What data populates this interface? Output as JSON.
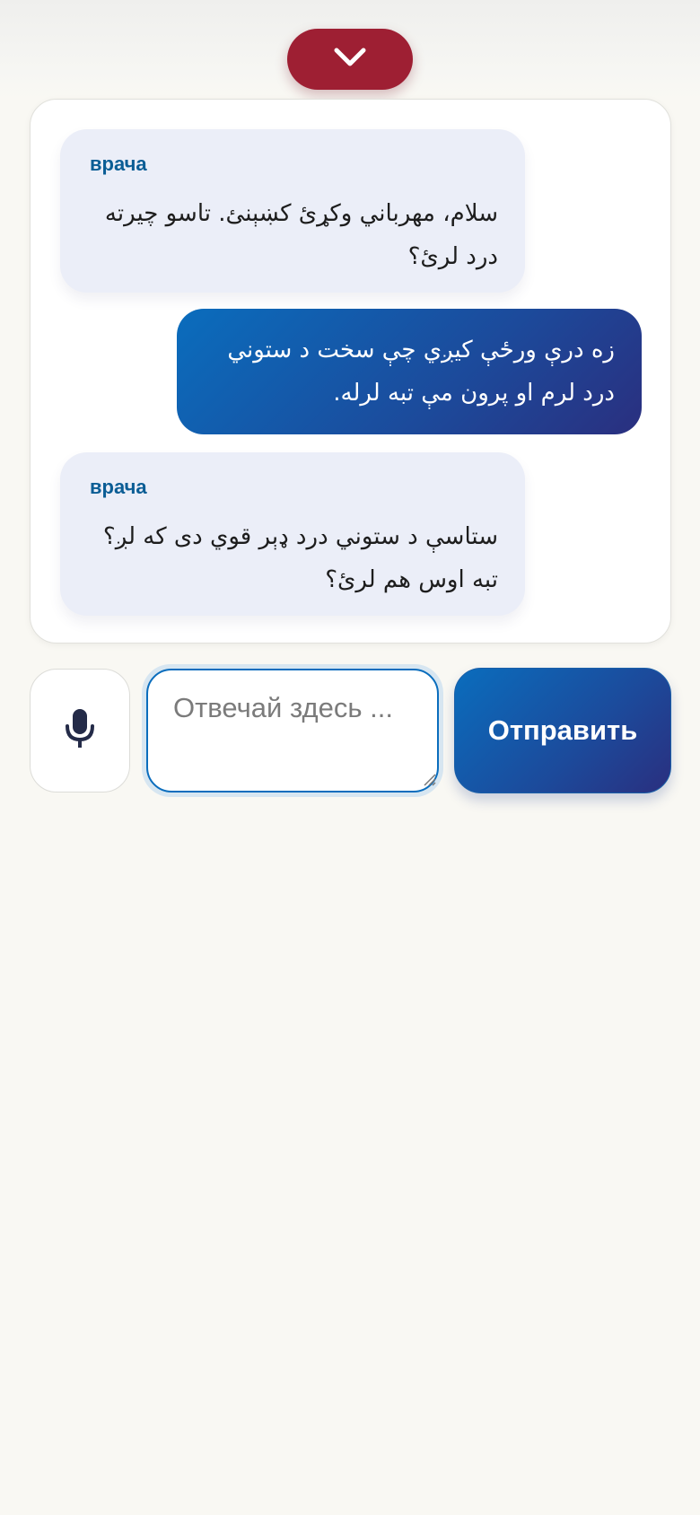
{
  "header": {
    "collapse_icon": "chevron-down-icon",
    "collapse_color": "#9e1f33"
  },
  "chat": {
    "messages": [
      {
        "role": "doctor",
        "sender": "врача",
        "lines": [
          "سلام، مهرباني وکړئ کښېنئ. تاسو چیرته",
          "درد لرئ؟"
        ]
      },
      {
        "role": "patient",
        "lines": [
          "زه درې ورځې کیږي چې سخت د ستوني",
          "درد لرم او پرون مې تبه لرله."
        ]
      },
      {
        "role": "doctor",
        "sender": "врача",
        "lines": [
          "ستاسې د ستوني درد ډېر قوي دی که لږ؟",
          "تبه اوس هم لرئ؟"
        ]
      }
    ]
  },
  "composer": {
    "mic_icon": "microphone-icon",
    "placeholder": "Отвечай здесь ...",
    "value": "",
    "send_label": "Отправить"
  },
  "colors": {
    "accent": "#0a6dbd",
    "accent_dark": "#2a2f7f",
    "doctor_bubble": "#ebeef8",
    "sender_label": "#0a5d95",
    "background": "#f9f8f3"
  }
}
